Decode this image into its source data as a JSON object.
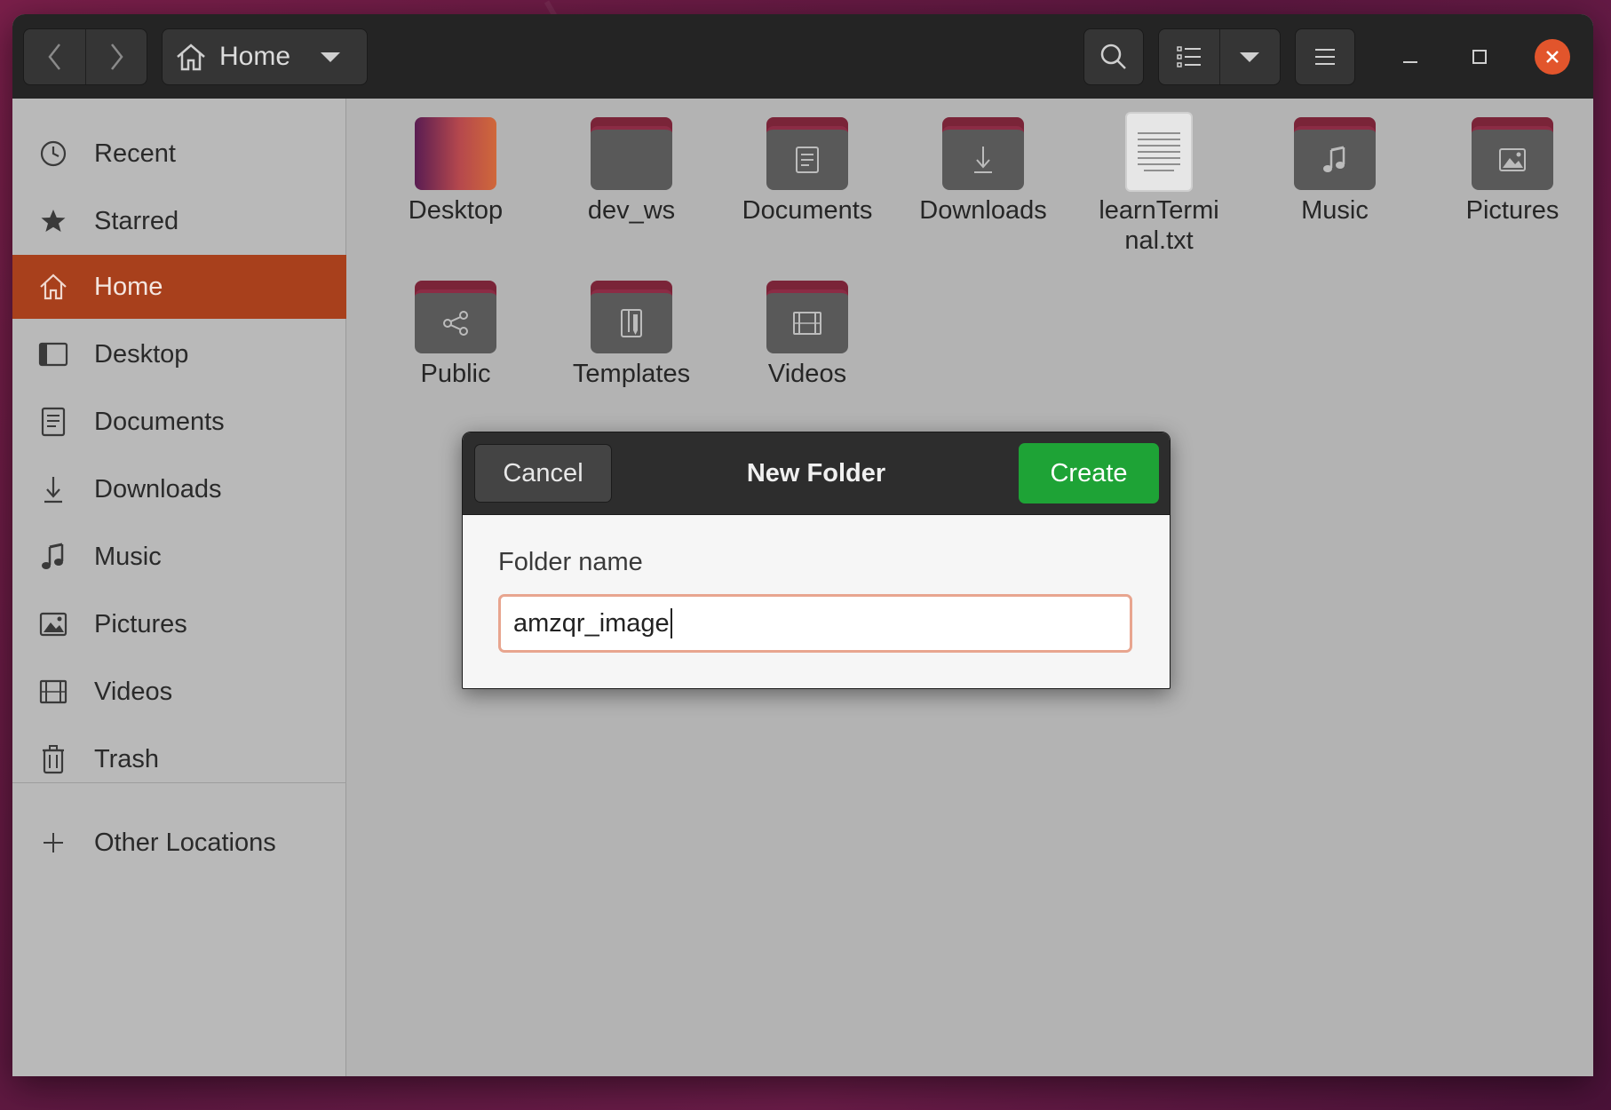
{
  "window": {
    "path_label": "Home"
  },
  "sidebar": {
    "items": [
      {
        "label": "Recent",
        "icon": "clock-icon"
      },
      {
        "label": "Starred",
        "icon": "star-icon"
      },
      {
        "label": "Home",
        "icon": "home-icon",
        "active": true
      },
      {
        "label": "Desktop",
        "icon": "desktop-icon"
      },
      {
        "label": "Documents",
        "icon": "document-icon"
      },
      {
        "label": "Downloads",
        "icon": "download-icon"
      },
      {
        "label": "Music",
        "icon": "music-icon"
      },
      {
        "label": "Pictures",
        "icon": "picture-icon"
      },
      {
        "label": "Videos",
        "icon": "video-icon"
      },
      {
        "label": "Trash",
        "icon": "trash-icon"
      }
    ],
    "other_locations": "Other Locations"
  },
  "files": [
    {
      "name": "Desktop",
      "type": "desktop-folder"
    },
    {
      "name": "dev_ws",
      "type": "folder"
    },
    {
      "name": "Documents",
      "type": "folder-documents"
    },
    {
      "name": "Downloads",
      "type": "folder-downloads"
    },
    {
      "name_line1": "learnTermi",
      "name_line2": "nal.txt",
      "type": "text-file"
    },
    {
      "name": "Music",
      "type": "folder-music"
    },
    {
      "name": "Pictures",
      "type": "folder-pictures"
    },
    {
      "name": "Public",
      "type": "folder-public"
    },
    {
      "name": "Templates",
      "type": "folder-templates"
    },
    {
      "name": "Videos",
      "type": "folder-videos"
    }
  ],
  "dialog": {
    "title": "New Folder",
    "cancel_label": "Cancel",
    "create_label": "Create",
    "field_label": "Folder name",
    "field_value": "amzqr_image"
  },
  "colors": {
    "accent": "#a8401c",
    "create_button": "#1ea336",
    "close_button": "#e2552c"
  }
}
